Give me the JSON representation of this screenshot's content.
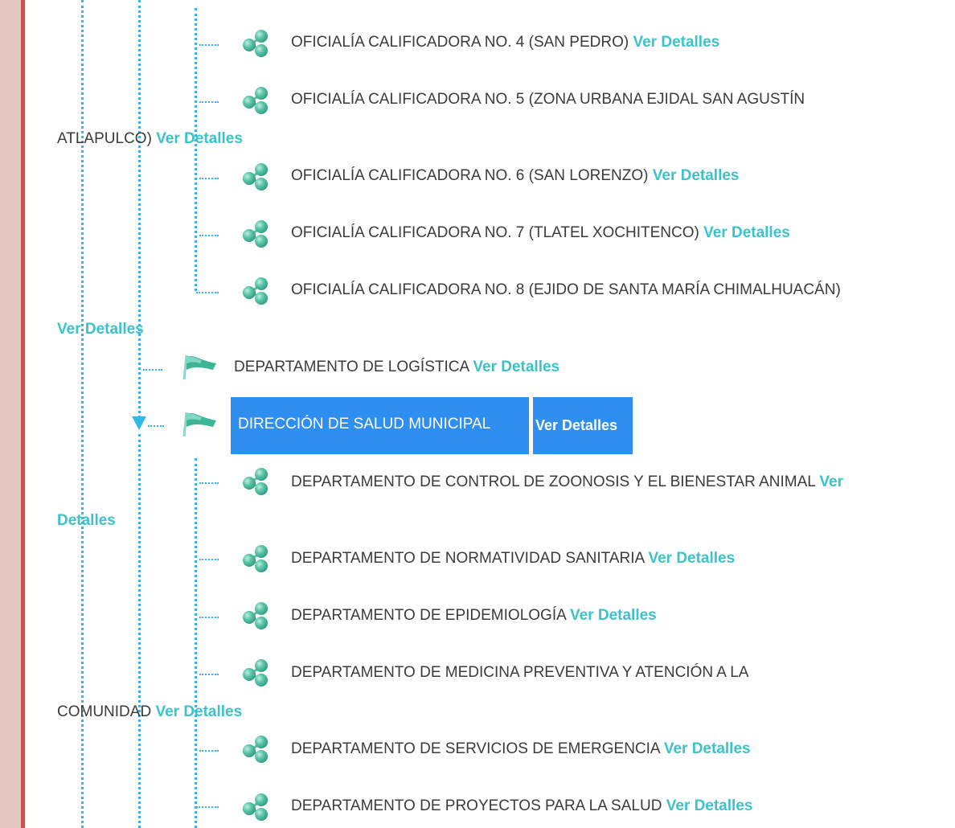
{
  "tree": {
    "items": [
      {
        "text": "OFICIALÍA CALIFICADORA NO. 4 (SAN PEDRO)",
        "link": "Ver Detalles"
      },
      {
        "text": "OFICIALÍA CALIFICADORA NO. 5 (ZONA URBANA EJIDAL SAN AGUSTÍN",
        "text2": "ATLAPULCO)",
        "link": "Ver Detalles"
      },
      {
        "text": "OFICIALÍA CALIFICADORA NO. 6 (SAN LORENZO)",
        "link": "Ver Detalles"
      },
      {
        "text": "OFICIALÍA CALIFICADORA NO. 7 (TLATEL XOCHITENCO)",
        "link": "Ver Detalles"
      },
      {
        "text": "OFICIALÍA CALIFICADORA NO. 8 (EJIDO DE SANTA MARÍA CHIMALHUACÁN)",
        "link": "Ver Detalles"
      },
      {
        "text": "DEPARTAMENTO DE LOGÍSTICA",
        "link": "Ver Detalles"
      },
      {
        "text": "DIRECCIÓN DE SALUD MUNICIPAL",
        "link": "Ver Detalles"
      },
      {
        "text": "DEPARTAMENTO DE CONTROL DE ZOONOSIS Y EL BIENESTAR ANIMAL",
        "link_a": "Ver",
        "link_b": "Detalles"
      },
      {
        "text": "DEPARTAMENTO DE NORMATIVIDAD SANITARIA",
        "link": "Ver Detalles"
      },
      {
        "text": "DEPARTAMENTO DE EPIDEMIOLOGÍA",
        "link": "Ver Detalles"
      },
      {
        "text": "DEPARTAMENTO DE MEDICINA PREVENTIVA Y ATENCIÓN A LA",
        "text2": "COMUNIDAD",
        "link": "Ver Detalles"
      },
      {
        "text": "DEPARTAMENTO DE SERVICIOS DE EMERGENCIA",
        "link": "Ver Detalles"
      },
      {
        "text": "DEPARTAMENTO DE PROYECTOS PARA LA SALUD",
        "link": "Ver Detalles"
      }
    ]
  },
  "colors": {
    "link": "#3cc3c8",
    "selected_bg": "#2f8ff0",
    "connector": "#34b3ee",
    "icon_green": "#4cbda0",
    "left_border": "#c0574e"
  },
  "icons": {
    "leaf_node": "molecule-cluster-icon",
    "branch_node": "flag-icon",
    "expand": "triangle-down-icon"
  }
}
